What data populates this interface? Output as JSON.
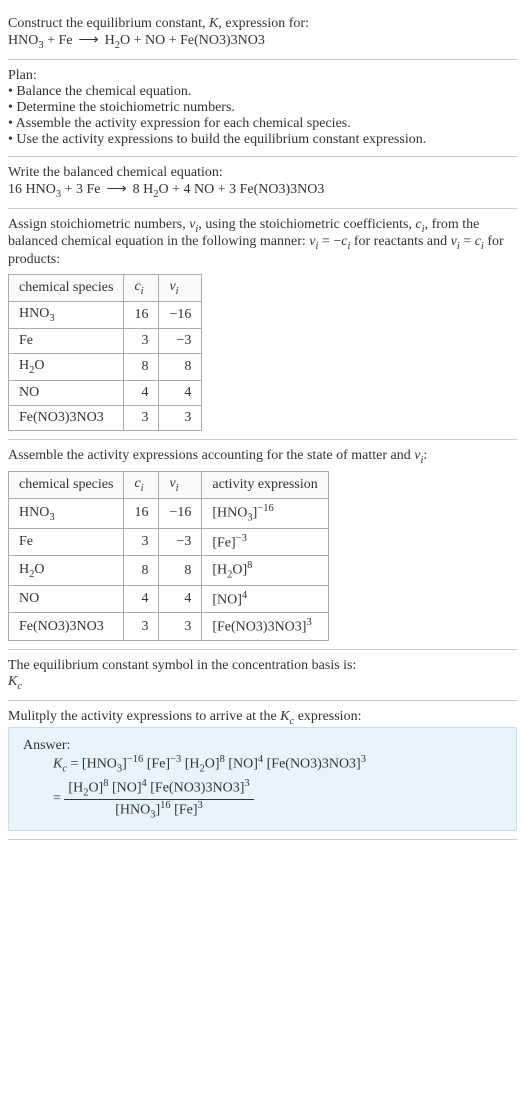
{
  "chart_data": [
    {
      "type": "table",
      "title": "stoichiometric numbers",
      "columns": [
        "chemical species",
        "c_i",
        "ν_i"
      ],
      "rows": [
        [
          "HNO3",
          16,
          -16
        ],
        [
          "Fe",
          3,
          -3
        ],
        [
          "H2O",
          8,
          8
        ],
        [
          "NO",
          4,
          4
        ],
        [
          "Fe(NO3)3NO3",
          3,
          3
        ]
      ]
    },
    {
      "type": "table",
      "title": "activity expressions",
      "columns": [
        "chemical species",
        "c_i",
        "ν_i",
        "activity expression"
      ],
      "rows": [
        [
          "HNO3",
          16,
          -16,
          "[HNO3]^-16"
        ],
        [
          "Fe",
          3,
          -3,
          "[Fe]^-3"
        ],
        [
          "H2O",
          8,
          8,
          "[H2O]^8"
        ],
        [
          "NO",
          4,
          4,
          "[NO]^4"
        ],
        [
          "Fe(NO3)3NO3",
          3,
          3,
          "[Fe(NO3)3NO3]^3"
        ]
      ]
    }
  ],
  "intro": {
    "line1_a": "Construct the equilibrium constant, ",
    "line1_b": ", expression for:",
    "K": "K",
    "eq_lhs1": "HNO",
    "eq_lhs1s": "3",
    "plus": " + ",
    "eq_lhs2": "Fe",
    "arrow": "⟶",
    "eq_rhs1": "H",
    "eq_rhs1s": "2",
    "eq_rhs1b": "O",
    "eq_rhs2": "NO",
    "eq_rhs3": "Fe(NO3)3NO3"
  },
  "plan": {
    "title": "Plan:",
    "b1": "• Balance the chemical equation.",
    "b2": "• Determine the stoichiometric numbers.",
    "b3": "• Assemble the activity expression for each chemical species.",
    "b4": "• Use the activity expressions to build the equilibrium constant expression."
  },
  "balanced": {
    "title": "Write the balanced chemical equation:",
    "c1": "16 ",
    "s1": "HNO",
    "s1s": "3",
    "c2": "3 ",
    "s2": "Fe",
    "c3": "8 ",
    "s3": "H",
    "s3s": "2",
    "s3b": "O",
    "c4": "4 ",
    "s4": "NO",
    "c5": "3 ",
    "s5": "Fe(NO3)3NO3"
  },
  "assign": {
    "t1": "Assign stoichiometric numbers, ",
    "nu": "ν",
    "i": "i",
    "t2": ", using the stoichiometric coefficients, ",
    "c": "c",
    "t3": ", from the balanced chemical equation in the following manner: ",
    "eq1a": " = −",
    "t4": " for reactants and ",
    "eq2a": " = ",
    "t5": " for products:",
    "h1": "chemical species",
    "h2": "c",
    "h3": "ν",
    "r1s": "HNO",
    "r1ss": "3",
    "r1c": "16",
    "r1n": "−16",
    "r2s": "Fe",
    "r2c": "3",
    "r2n": "−3",
    "r3s": "H",
    "r3ss": "2",
    "r3b": "O",
    "r3c": "8",
    "r3n": "8",
    "r4s": "NO",
    "r4c": "4",
    "r4n": "4",
    "r5s": "Fe(NO3)3NO3",
    "r5c": "3",
    "r5n": "3"
  },
  "activity": {
    "title1": "Assemble the activity expressions accounting for the state of matter and ",
    "title2": ":",
    "h4": "activity expression",
    "e1a": "[HNO",
    "e1b": "]",
    "e1c": "−16",
    "e2a": "[Fe]",
    "e2c": "−3",
    "e3a": "[H",
    "e3b": "O]",
    "e3c": "8",
    "e4a": "[NO]",
    "e4c": "4",
    "e5a": "[Fe(NO3)3NO3]",
    "e5c": "3"
  },
  "symbol": {
    "t1": "The equilibrium constant symbol in the concentration basis is:",
    "K": "K",
    "c": "c"
  },
  "final": {
    "t1": "Mulitply the activity expressions to arrive at the ",
    "t2": " expression:",
    "ans": "Answer:",
    "eq": " = ",
    "lb": "[HNO",
    "lbs": "3",
    "rb": "]",
    "p1e": "−16",
    "fe": "[Fe]",
    "fee": "−3",
    "h2o": "[H",
    "h2os": "2",
    "h2ob": "O]",
    "h2oe": "8",
    "no": "[NO]",
    "noe": "4",
    "fen": "[Fe(NO3)3NO3]",
    "fene": "3",
    "eq2": " = ",
    "d_hno_e": "16",
    "d_fe_e": "3"
  }
}
